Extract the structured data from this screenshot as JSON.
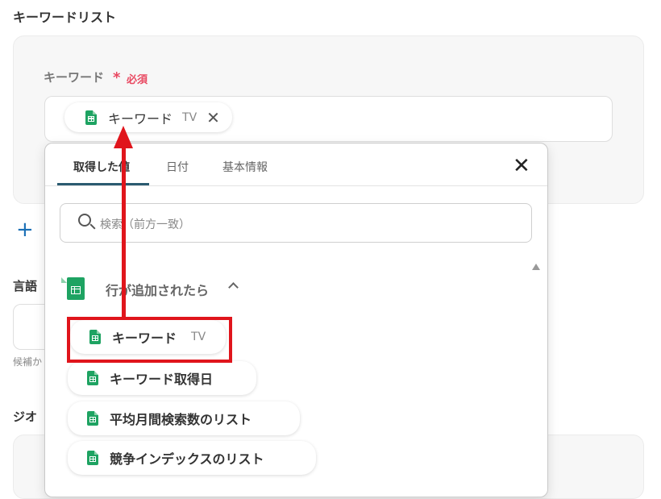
{
  "form": {
    "section_title": "キーワードリスト",
    "keyword_label": "キーワード",
    "required_star": "*",
    "required_text": "必須",
    "selected_chip": {
      "label": "キーワード",
      "tag": "TV",
      "close_icon": "close-icon"
    },
    "add_icon": "plus-icon",
    "language_label": "言語",
    "hint_text": "候補か",
    "geo_label": "ジオ"
  },
  "popup": {
    "tabs": [
      {
        "label": "取得した値",
        "active": true
      },
      {
        "label": "日付",
        "active": false
      },
      {
        "label": "基本情報",
        "active": false
      }
    ],
    "close_icon": "close-icon",
    "search_placeholder": "検索（前方一致）",
    "group": {
      "label": "行が追加されたら",
      "icon": "google-sheets-icon",
      "expanded": true
    },
    "items": [
      {
        "label": "キーワード",
        "tag": "TV",
        "highlighted": true
      },
      {
        "label": "キーワード取得日",
        "tag": ""
      },
      {
        "label": "平均月間検索数のリスト",
        "tag": ""
      },
      {
        "label": "競争インデックスのリスト",
        "tag": ""
      }
    ]
  },
  "colors": {
    "required": "#e94861",
    "accent_tab": "#2b5b70",
    "sheets_green": "#1ea362",
    "annotation_red": "#e0151c",
    "add_icon": "#1a6fb5"
  }
}
